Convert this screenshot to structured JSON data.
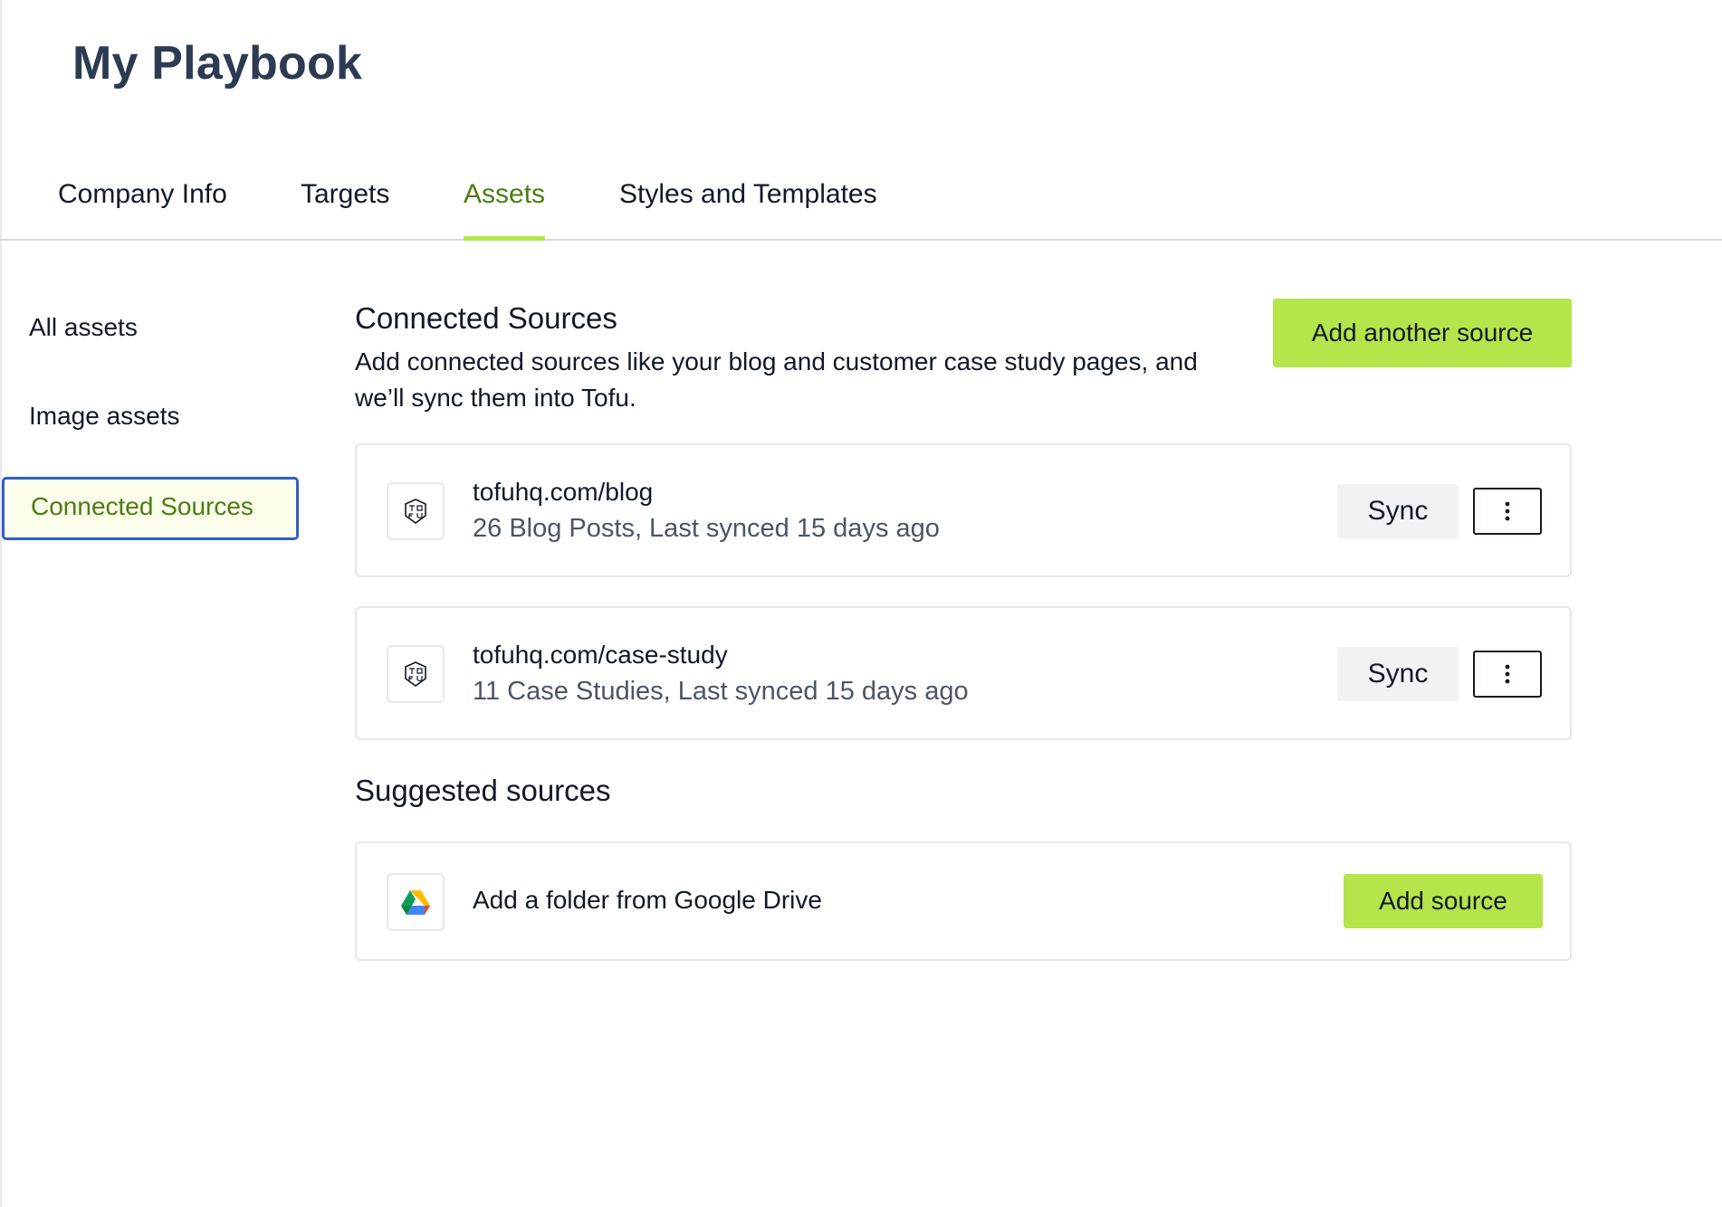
{
  "page": {
    "title": "My Playbook"
  },
  "tabs": [
    {
      "label": "Company Info",
      "active": false
    },
    {
      "label": "Targets",
      "active": false
    },
    {
      "label": "Assets",
      "active": true
    },
    {
      "label": "Styles and Templates",
      "active": false
    }
  ],
  "sidebar": {
    "items": [
      {
        "label": "All assets",
        "active": false
      },
      {
        "label": "Image assets",
        "active": false
      },
      {
        "label": "Connected Sources",
        "active": true
      }
    ]
  },
  "connected": {
    "title": "Connected Sources",
    "description": "Add connected sources like your blog and customer case study pages, and we’ll sync them into Tofu.",
    "add_button": "Add another source",
    "sources": [
      {
        "name": "tofuhq.com/blog",
        "meta": "26 Blog Posts, Last synced 15 days ago",
        "sync_label": "Sync",
        "icon": "tofu-logo-icon"
      },
      {
        "name": "tofuhq.com/case-study",
        "meta": "11 Case Studies, Last synced 15 days ago",
        "sync_label": "Sync",
        "icon": "tofu-logo-icon"
      }
    ]
  },
  "suggested": {
    "title": "Suggested sources",
    "items": [
      {
        "label": "Add a folder from Google Drive",
        "button": "Add source",
        "icon": "google-drive-icon"
      }
    ]
  },
  "colors": {
    "accent": "#b4e54a",
    "active_text": "#4d7c14",
    "focus_border": "#2f5fc8"
  }
}
